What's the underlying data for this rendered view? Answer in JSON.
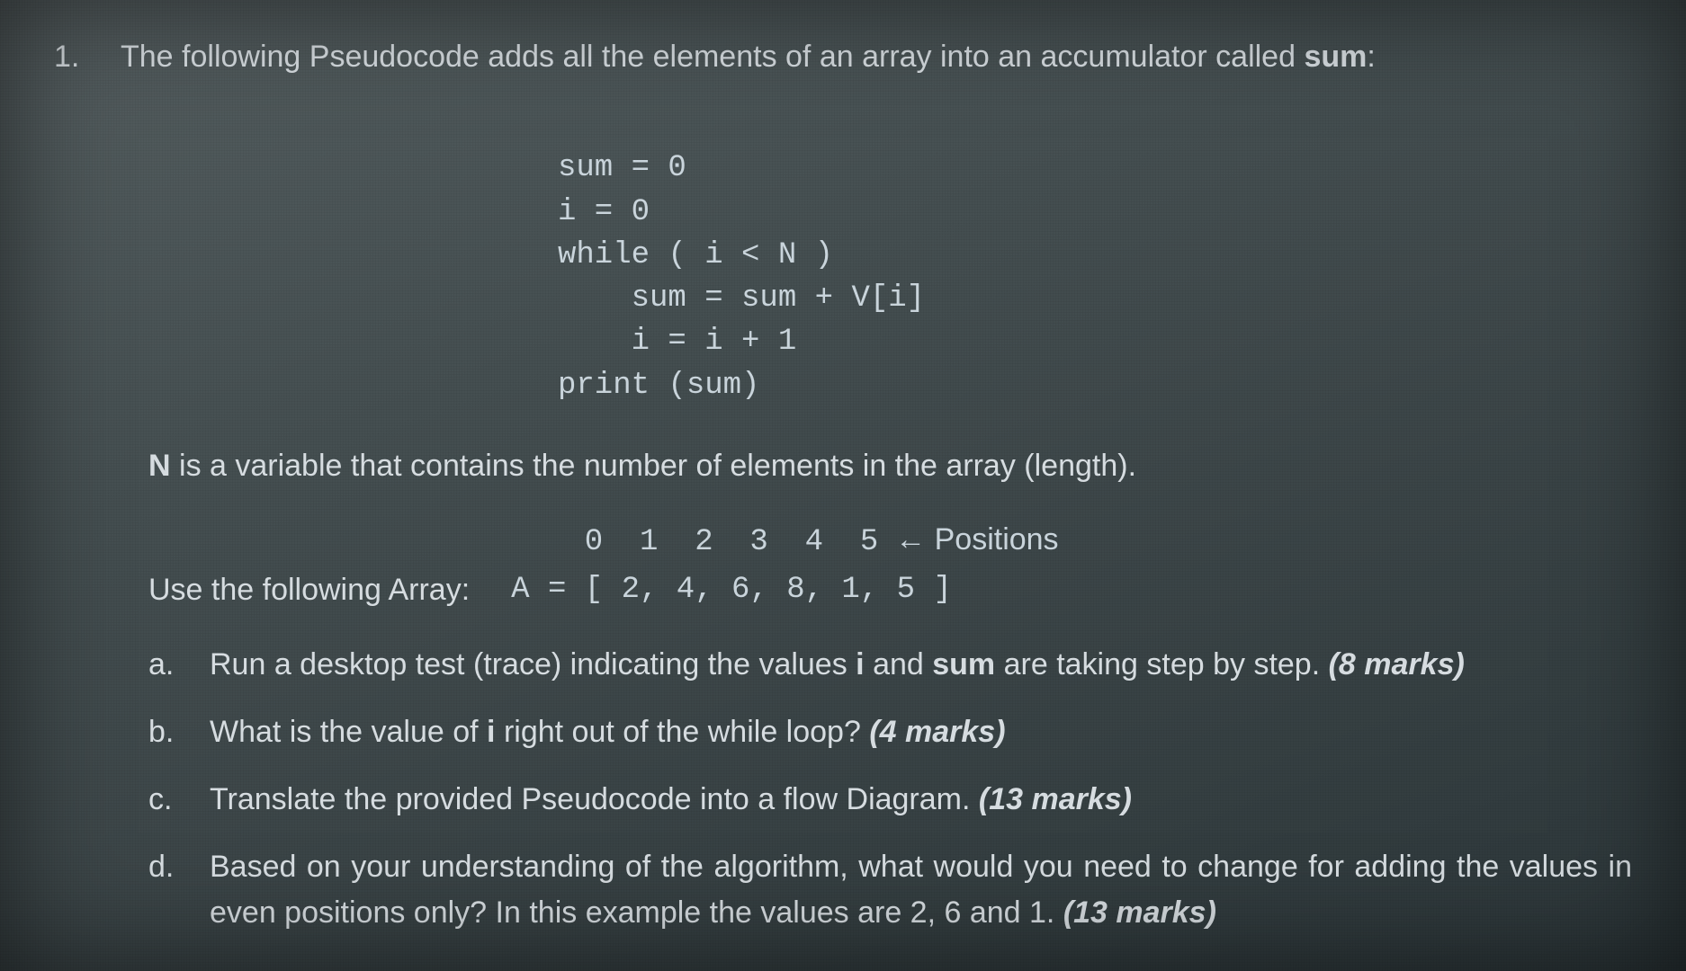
{
  "question": {
    "number": "1.",
    "intro_before_bold": "The following Pseudocode adds all the elements of an array into an accumulator called ",
    "intro_bold": "sum",
    "intro_after_bold": ":"
  },
  "code": {
    "l1": "sum = 0",
    "l2": "i = 0",
    "l3": "while ( i < N )",
    "l4": "    sum = sum + V[i]",
    "l5": "    i = i + 1",
    "l6": "print (sum)"
  },
  "n_desc": {
    "bold": "N",
    "rest": " is a variable that contains the number of elements in the array (length)."
  },
  "array": {
    "label": "Use the following Array:",
    "positions_digits": "0  1  2  3  4  5",
    "positions_arrow": "  ←",
    "positions_word": " Positions",
    "values": "A = [ 2, 4, 6, 8, 1, 5 ]"
  },
  "subs": {
    "a": {
      "letter": "a.",
      "t1": "Run a desktop test (trace) indicating the values ",
      "b1": "i",
      "t2": " and ",
      "b2": "sum",
      "t3": " are taking step by step. ",
      "marks": "(8 marks)"
    },
    "b": {
      "letter": "b.",
      "t1": "What is the value of ",
      "b1": "i",
      "t2": " right out of the while loop? ",
      "marks": "(4 marks)"
    },
    "c": {
      "letter": "c.",
      "t1": "Translate the provided Pseudocode into a flow Diagram. ",
      "marks": "(13 marks)"
    },
    "d": {
      "letter": "d.",
      "t1": "Based on your understanding of the algorithm, what would you need to change for adding the values in even positions only? In this example the values are 2, 6 and 1. ",
      "marks": "(13 marks)"
    }
  }
}
